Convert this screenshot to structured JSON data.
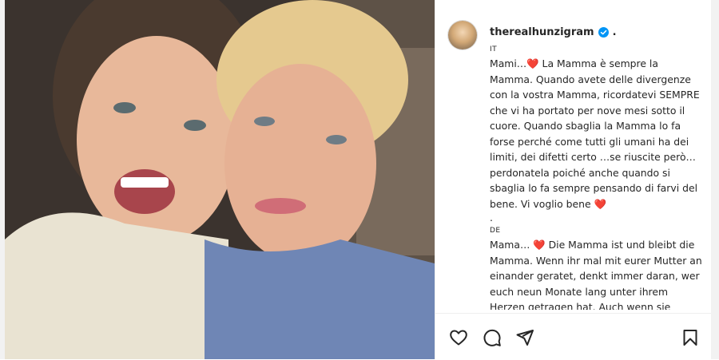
{
  "post": {
    "username": "therealhunzigram",
    "username_suffix": ".",
    "verified": true,
    "photo_icon": "photo-image"
  },
  "caption": {
    "sections": [
      {
        "lang": "IT",
        "text": "Mami…❤️ La Mamma è sempre la Mamma. Quando avete delle divergenze con la vostra Mamma, ricordatevi SEMPRE che vi ha portato per nove mesi sotto il cuore. Quando sbaglia la Mamma lo fa forse perché come tutti gli umani ha dei limiti, dei difetti certo …se riuscite però…perdonatela poiché anche quando si sbaglia lo fa sempre pensando di farvi del bene. Vi voglio bene ❤️"
      },
      {
        "separator": "."
      },
      {
        "lang": "DE",
        "text": "Mama… ❤️ Die Mamma ist und bleibt die Mamma. Wenn ihr mal mit eurer Mutter an einander geratet, denkt immer daran, wer euch neun Monate lang unter ihrem Herzen getragen hat. Auch wenn sie Fehler macht, tut sie es, weil sie nicht anders kann"
      }
    ]
  },
  "actions": {
    "like_icon": "heart-icon",
    "comment_icon": "comment-icon",
    "share_icon": "share-icon",
    "save_icon": "bookmark-icon"
  },
  "colors": {
    "verified": "#0095f6",
    "heart": "#e0245e",
    "text": "#262626"
  }
}
